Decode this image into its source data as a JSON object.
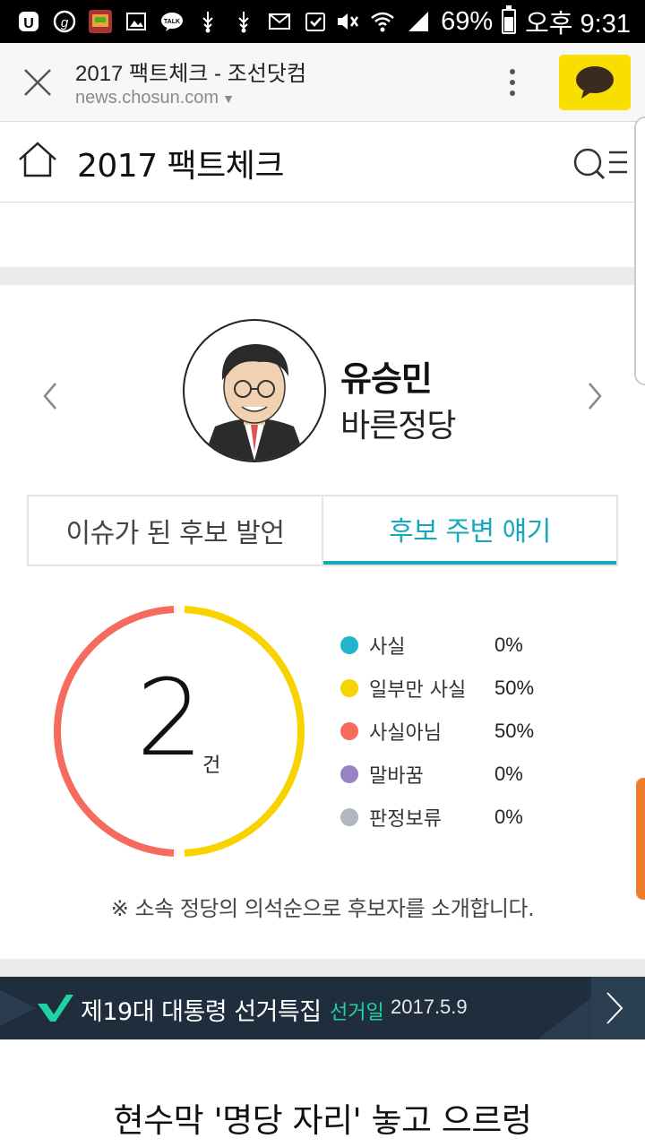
{
  "status_bar": {
    "battery": "69%",
    "time": "오후 9:31"
  },
  "browser": {
    "title": "2017 팩트체크 - 조선닷컴",
    "url": "news.chosun.com"
  },
  "header": {
    "title": "2017 팩트체크"
  },
  "candidate": {
    "name": "유승민",
    "party": "바른정당"
  },
  "tabs": [
    {
      "label": "이슈가 된 후보 발언"
    },
    {
      "label": "후보 주변 얘기"
    }
  ],
  "stats": {
    "count": "2",
    "unit": "건",
    "legend": [
      {
        "label": "사실",
        "value": "0%",
        "color": "#20b5cc"
      },
      {
        "label": "일부만 사실",
        "value": "50%",
        "color": "#f8d300"
      },
      {
        "label": "사실아님",
        "value": "50%",
        "color": "#f56b5e"
      },
      {
        "label": "말바꿈",
        "value": "0%",
        "color": "#9a83c4"
      },
      {
        "label": "판정보류",
        "value": "0%",
        "color": "#b2b7bd"
      }
    ]
  },
  "note": "※ 소속 정당의 의석순으로 후보자를 소개합니다.",
  "banner": {
    "title": "제19대 대통령 선거특집",
    "date_label": "선거일",
    "date": "2017.5.9"
  },
  "headline": "현수막 '명당 자리' 놓고 으르렁"
}
